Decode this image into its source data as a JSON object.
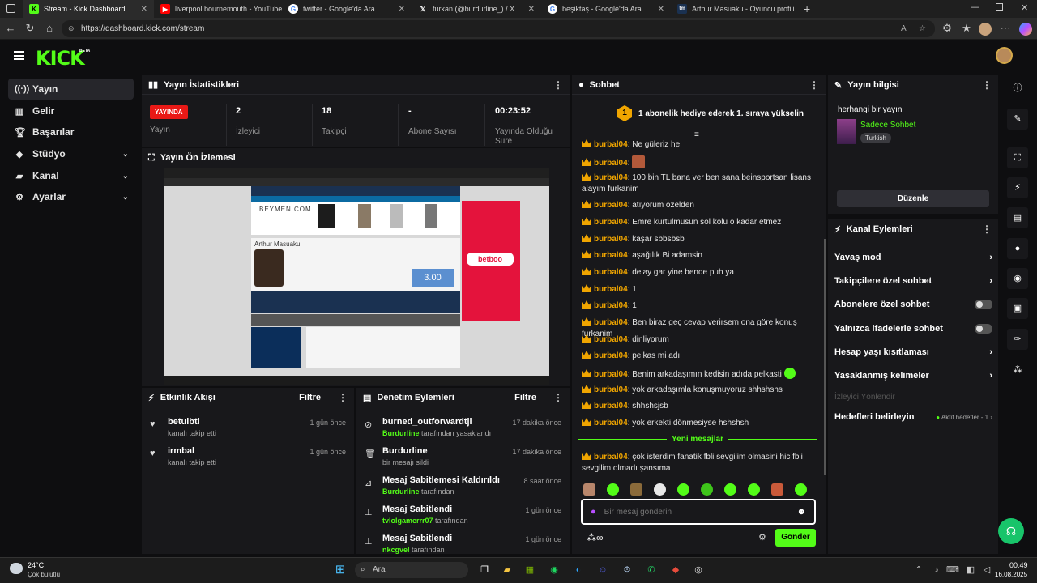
{
  "browser": {
    "tabs": [
      {
        "label": "Stream - Kick Dashboard",
        "icon": "kick-icon",
        "color": "#53fc18"
      },
      {
        "label": "liverpool bournemouth - YouTube",
        "icon": "youtube-icon",
        "color": "#ff0000"
      },
      {
        "label": "twitter - Google'da Ara",
        "icon": "google-icon",
        "color": "#ffffff"
      },
      {
        "label": "furkan (@burdurline_) / X",
        "icon": "x-icon",
        "color": "#ffffff"
      },
      {
        "label": "beşiktaş - Google'da Ara",
        "icon": "google-icon",
        "color": "#ffffff"
      },
      {
        "label": "Arthur Masuaku - Oyuncu profili",
        "icon": "tm-icon",
        "color": "#1a3151"
      }
    ],
    "url": "https://dashboard.kick.com/stream"
  },
  "kick": {
    "logo": "KICK",
    "beta": "BETA"
  },
  "sidebar": {
    "items": [
      {
        "label": "Yayın"
      },
      {
        "label": "Gelir"
      },
      {
        "label": "Başarılar"
      },
      {
        "label": "Stüdyo"
      },
      {
        "label": "Kanal"
      },
      {
        "label": "Ayarlar"
      }
    ]
  },
  "stats": {
    "title": "Yayın İstatistikleri",
    "live_badge": "YAYINDA",
    "items": [
      {
        "value": "",
        "label": "Yayın"
      },
      {
        "value": "2",
        "label": "İzleyici"
      },
      {
        "value": "18",
        "label": "Takipçi"
      },
      {
        "value": "-",
        "label": "Abone Sayısı"
      },
      {
        "value": "00:23:52",
        "label": "Yayında Olduğu Süre"
      }
    ]
  },
  "preview": {
    "title": "Yayın Ön İzlemesi",
    "player_name": "Arthur Masuaku",
    "brand": "BEYMEN.COM",
    "ad": "betboo",
    "odds": "3.00"
  },
  "activity": {
    "title": "Etkinlik Akışı",
    "filter": "Filtre",
    "items": [
      {
        "name": "betulbtl",
        "sub": "kanalı takip etti",
        "time": "1 gün önce"
      },
      {
        "name": "irmbal",
        "sub": "kanalı takip etti",
        "time": "1 gün önce"
      }
    ]
  },
  "moderation": {
    "title": "Denetim Eylemleri",
    "filter": "Filtre",
    "items": [
      {
        "name": "burned_outforwardtjl",
        "by": "Burdurline",
        "sub": "tarafından yasaklandı",
        "time": "17 dakika önce"
      },
      {
        "name": "Burdurline",
        "by": "",
        "sub": "bir mesajı sildi",
        "time": "17 dakika önce"
      },
      {
        "name": "Mesaj Sabitlemesi Kaldırıldı",
        "by": "Burdurline",
        "sub": "tarafından",
        "time": "8 saat önce"
      },
      {
        "name": "Mesaj Sabitlendi",
        "by": "tvlolgamerrr07",
        "sub": "tarafından",
        "time": "1 gün önce"
      },
      {
        "name": "Mesaj Sabitlendi",
        "by": "nkcgvel",
        "sub": "tarafından",
        "time": "1 gün önce"
      }
    ]
  },
  "chat": {
    "title": "Sohbet",
    "gift_banner": "1 abonelik hediye ederek 1. sıraya yükselin",
    "gift_rank": "1",
    "new_messages": "Yeni mesajlar",
    "input_placeholder": "Bir mesaj gönderin",
    "send": "Gönder",
    "messages": [
      {
        "user": "burbal04",
        "text": "Ne güleriz he"
      },
      {
        "user": "burbal04",
        "text": ""
      },
      {
        "user": "burbal04",
        "text": "100 bin TL bana ver ben sana beinsportsan lisans alayım furkanim"
      },
      {
        "user": "burbal04",
        "text": "atıyorum özelden"
      },
      {
        "user": "burbal04",
        "text": "Emre kurtulmusun sol kolu o kadar etmez"
      },
      {
        "user": "burbal04",
        "text": "kaşar sbbsbsb"
      },
      {
        "user": "burbal04",
        "text": "aşağılık Bi adamsin"
      },
      {
        "user": "burbal04",
        "text": "delay gar yine bende puh ya"
      },
      {
        "user": "burbal04",
        "text": "1"
      },
      {
        "user": "burbal04",
        "text": "1"
      },
      {
        "user": "burbal04",
        "text": "Ben biraz geç cevap verirsem ona göre konuş furkanim"
      },
      {
        "user": "burbal04",
        "text": "dinliyorum"
      },
      {
        "user": "burbal04",
        "text": "pelkas mi adı"
      },
      {
        "user": "burbal04",
        "text": "Benim arkadaşımın kedisin adıda pelkasti"
      },
      {
        "user": "burbal04",
        "text": "yok arkadaşımla konuşmuyoruz shhshshs"
      },
      {
        "user": "burbal04",
        "text": "shhshsjsb"
      },
      {
        "user": "burbal04",
        "text": "yok erkekti dönmesiyse hshshsh"
      }
    ],
    "last_message": {
      "user": "burbal04",
      "text": "çok isterdim fanatik fbli sevgilim olmasini hic fbli sevgilim olmadı şansıma"
    }
  },
  "stream_info": {
    "title": "Yayın bilgisi",
    "stream_title": "herhangi bir yayın",
    "category": "Sadece Sohbet",
    "tag": "Turkish",
    "edit": "Düzenle"
  },
  "channel_actions": {
    "title": "Kanal Eylemleri",
    "items": [
      {
        "label": "Yavaş mod",
        "kind": "chevron"
      },
      {
        "label": "Takipçilere özel sohbet",
        "kind": "chevron"
      },
      {
        "label": "Abonelere özel sohbet",
        "kind": "toggle"
      },
      {
        "label": "Yalnızca ifadelerle sohbet",
        "kind": "toggle"
      },
      {
        "label": "Hesap yaşı kısıtlaması",
        "kind": "chevron"
      },
      {
        "label": "Yasaklanmış kelimeler",
        "kind": "chevron"
      },
      {
        "label": "İzleyici Yönlendir",
        "kind": "disabled"
      },
      {
        "label": "Hedefleri belirleyin",
        "kind": "goal"
      }
    ],
    "goal_status": "Aktif hedefler - 1"
  },
  "taskbar": {
    "weather_temp": "24°C",
    "weather_desc": "Çok bulutlu",
    "search": "Ara",
    "time": "00:49",
    "date": "16.08.2025"
  },
  "colors": {
    "accent": "#53fc18",
    "live": "#e91916",
    "username": "#f0a500"
  }
}
